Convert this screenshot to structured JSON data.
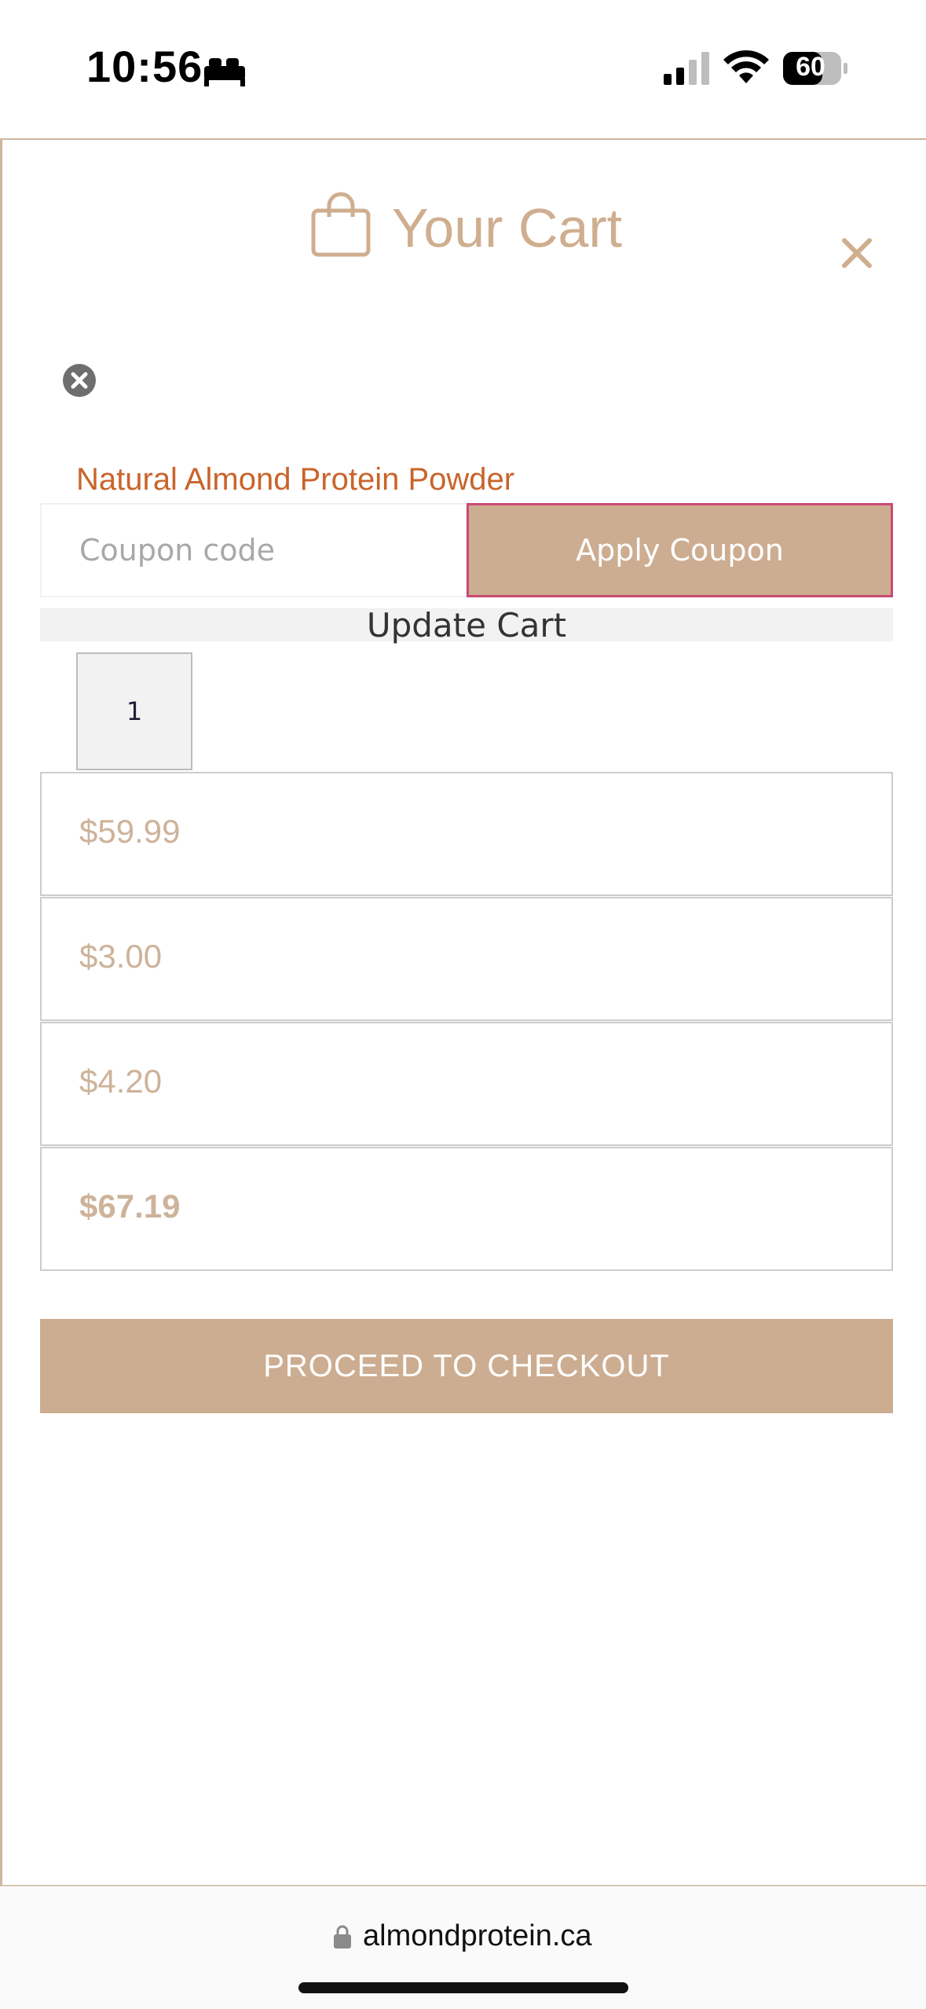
{
  "status_bar": {
    "time": "10:56",
    "battery": "60"
  },
  "cart": {
    "title": "Your Cart",
    "product_name": "Natural Almond Protein Powder",
    "coupon_placeholder": "Coupon code",
    "apply_coupon_label": "Apply Coupon",
    "update_cart_label": "Update Cart",
    "quantity": "1",
    "totals": {
      "subtotal": "$59.99",
      "line2": "$3.00",
      "line3": "$4.20",
      "total": "$67.19"
    },
    "checkout_label": "PROCEED TO CHECKOUT"
  },
  "browser": {
    "url": "almondprotein.ca"
  },
  "colors": {
    "accent": "#ccad91",
    "product_link": "#c9642b",
    "coupon_border": "#c94a72"
  },
  "icons": {
    "close": "close-icon",
    "bag": "shopping-bag-icon",
    "remove": "remove-item-icon",
    "lock": "lock-icon"
  }
}
